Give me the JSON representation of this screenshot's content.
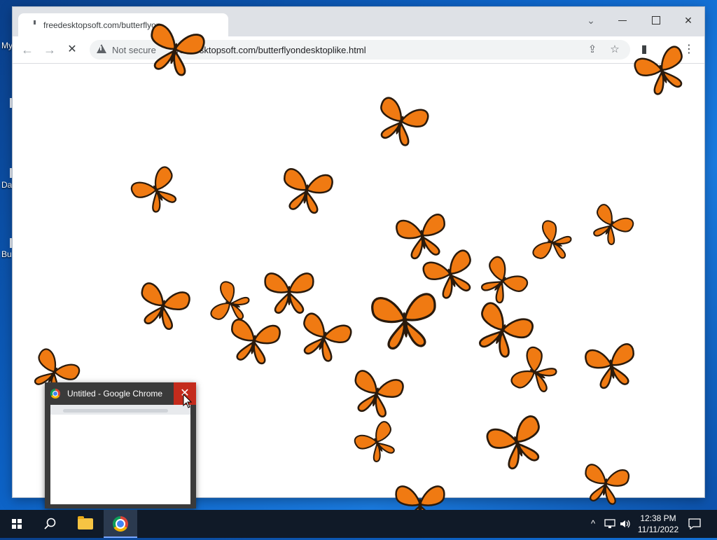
{
  "desktop": {
    "icon_labels": [
      "My",
      "Da",
      "Bu"
    ]
  },
  "browser": {
    "tab": {
      "title": "freedesktopsoft.com/butterflyon"
    },
    "window_controls": {
      "minimize": "minimize",
      "maximize": "maximize",
      "close": "✕",
      "tab_search": "⌄"
    },
    "nav": {
      "back": "←",
      "forward": "→",
      "stop": "✕"
    },
    "omnibox": {
      "security_label": "Not secure",
      "url": "freedesktopsoft.com/butterflyondesktoplike.html"
    },
    "icons": {
      "share": "share-icon",
      "bookmark": "star-icon",
      "sidebar": "side-panel-icon",
      "menu": "kebab-menu-icon"
    }
  },
  "preview": {
    "title": "Untitled - Google Chrome",
    "close": "✕"
  },
  "taskbar": {
    "apps": [
      "file-explorer",
      "google-chrome"
    ],
    "tray": {
      "chevron": "^",
      "network": "network-icon",
      "volume": "volume-icon"
    },
    "time": "12:38 PM",
    "date": "11/11/2022"
  },
  "colors": {
    "butterfly_orange": "#f07a12",
    "butterfly_dark": "#2a1a0c",
    "accent_red": "#c42b1c",
    "taskbar": "#101a28"
  }
}
